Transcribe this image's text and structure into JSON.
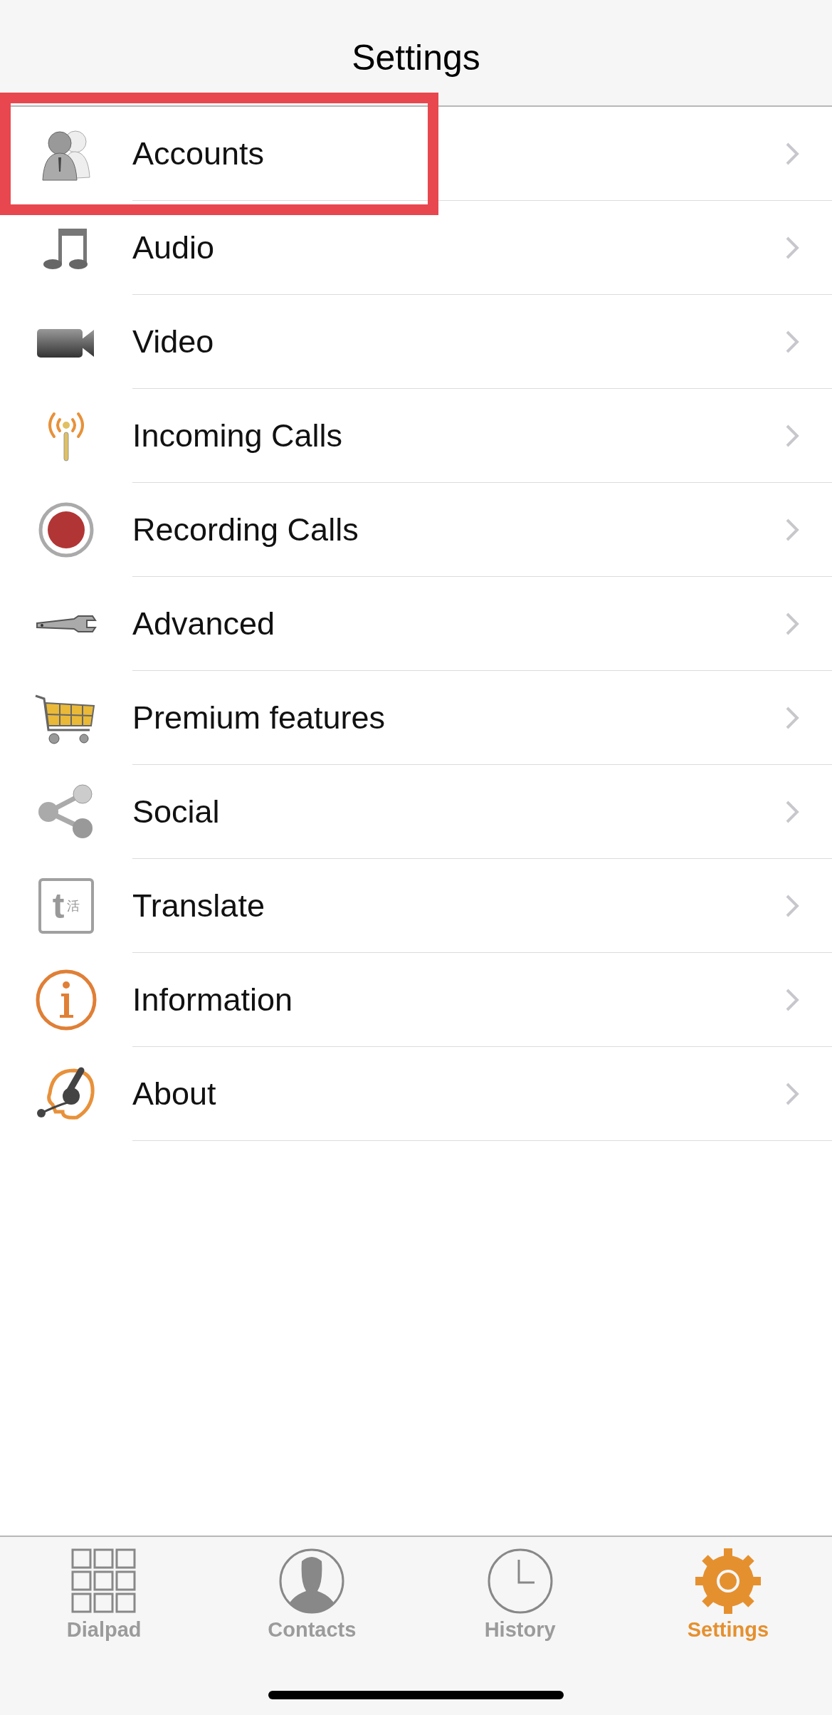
{
  "header": {
    "title": "Settings"
  },
  "items": [
    {
      "kind": "accounts",
      "label": "Accounts",
      "highlighted": true
    },
    {
      "kind": "audio",
      "label": "Audio",
      "highlighted": false
    },
    {
      "kind": "video",
      "label": "Video",
      "highlighted": false
    },
    {
      "kind": "incoming",
      "label": "Incoming Calls",
      "highlighted": false
    },
    {
      "kind": "recording",
      "label": "Recording Calls",
      "highlighted": false
    },
    {
      "kind": "advanced",
      "label": "Advanced",
      "highlighted": false
    },
    {
      "kind": "premium",
      "label": "Premium features",
      "highlighted": false
    },
    {
      "kind": "social",
      "label": "Social",
      "highlighted": false
    },
    {
      "kind": "translate",
      "label": "Translate",
      "highlighted": false,
      "icon_letter": "t",
      "icon_glyph": "活"
    },
    {
      "kind": "information",
      "label": "Information",
      "highlighted": false
    },
    {
      "kind": "about",
      "label": "About",
      "highlighted": false
    }
  ],
  "tabs": [
    {
      "kind": "dialpad",
      "label": "Dialpad",
      "selected": false
    },
    {
      "kind": "contacts",
      "label": "Contacts",
      "selected": false
    },
    {
      "kind": "history",
      "label": "History",
      "selected": false
    },
    {
      "kind": "settings",
      "label": "Settings",
      "selected": true
    }
  ]
}
